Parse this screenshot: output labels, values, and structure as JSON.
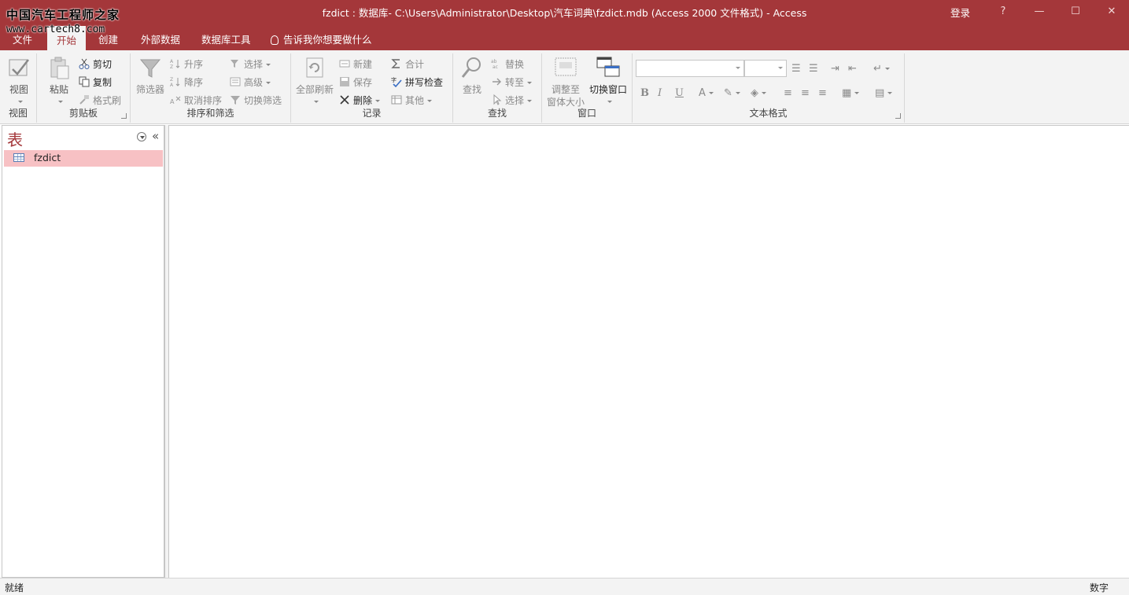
{
  "window": {
    "title": "fzdict : 数据库- C:\\Users\\Administrator\\Desktop\\汽车词典\\fzdict.mdb (Access 2000 文件格式)  -  Access",
    "signin": "登录",
    "help": "?",
    "minimize": "—",
    "maximize": "☐",
    "close": "✕"
  },
  "watermark": {
    "line1": "中国汽车工程师之家",
    "line2": "www.cartech8.com"
  },
  "tabs": [
    "文件",
    "开始",
    "创建",
    "外部数据",
    "数据库工具"
  ],
  "tell_me": "告诉我你想要做什么",
  "ribbon": {
    "view": {
      "button": "视图",
      "label": "视图"
    },
    "clipboard": {
      "paste": "粘贴",
      "cut": "剪切",
      "copy": "复制",
      "format_painter": "格式刷",
      "label": "剪贴板"
    },
    "sort_filter": {
      "filter": "筛选器",
      "ascending": "升序",
      "descending": "降序",
      "remove_sort": "取消排序",
      "selection": "选择",
      "advanced": "高级",
      "toggle_filter": "切换筛选",
      "label": "排序和筛选"
    },
    "records": {
      "refresh_all": "全部刷新",
      "new": "新建",
      "save": "保存",
      "delete": "删除",
      "totals": "合计",
      "spelling": "拼写检查",
      "more": "其他",
      "label": "记录"
    },
    "find": {
      "find": "查找",
      "replace": "替换",
      "goto": "转至",
      "select": "选择",
      "label": "查找"
    },
    "window": {
      "fit_line1": "调整至",
      "fit_line2": "窗体大小",
      "switch": "切换窗口",
      "label": "窗口"
    },
    "text_format": {
      "bold": "B",
      "italic": "I",
      "underline": "U",
      "label": "文本格式"
    }
  },
  "nav": {
    "header": "表",
    "collapse": "«",
    "items": [
      {
        "label": "fzdict"
      }
    ]
  },
  "status": {
    "left": "就绪",
    "right": "数字"
  }
}
